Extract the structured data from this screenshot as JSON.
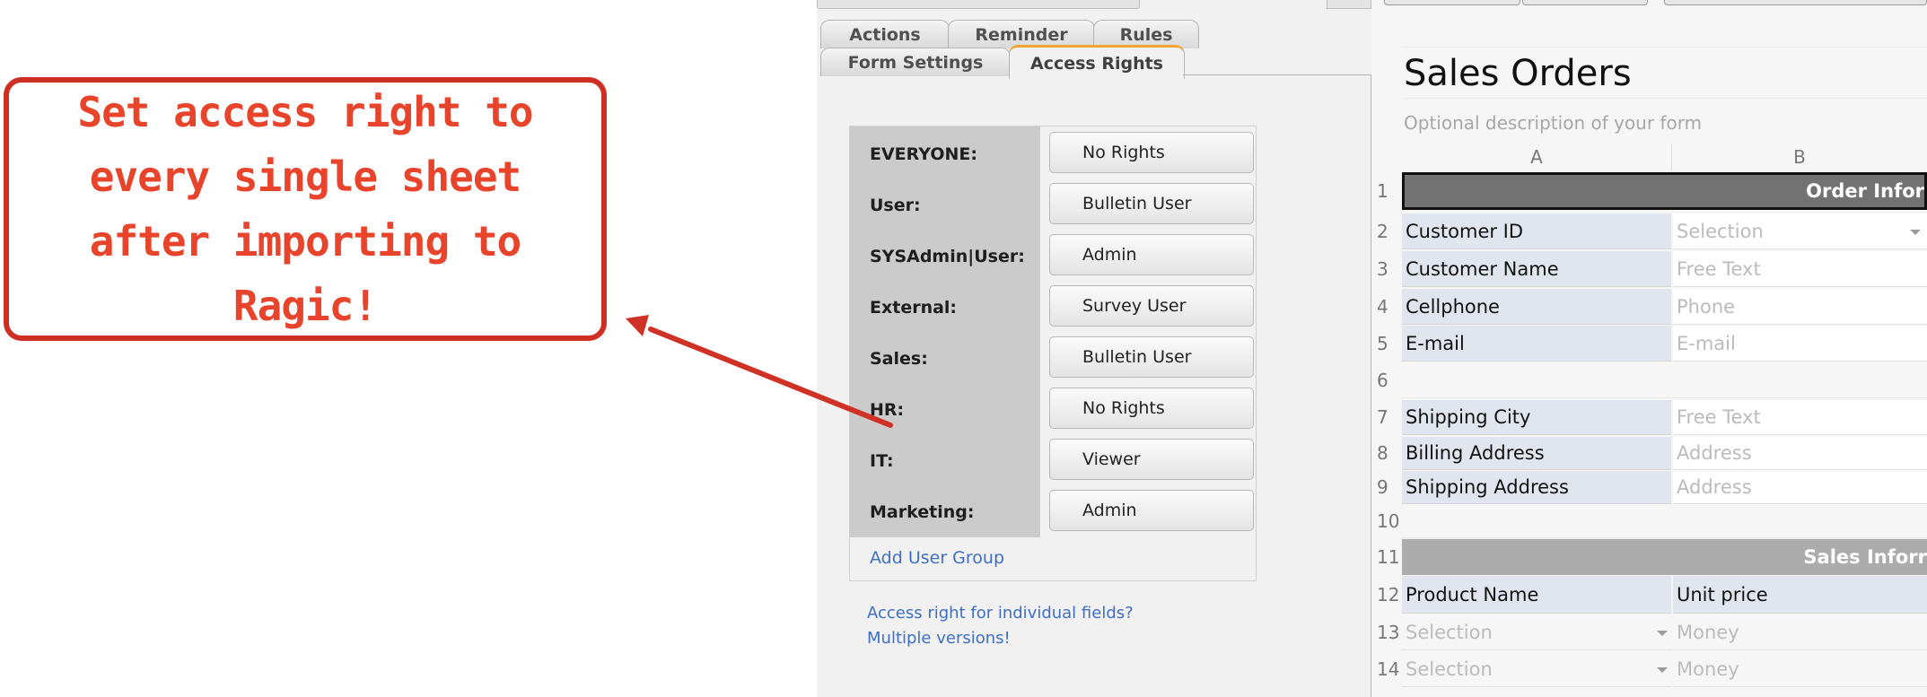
{
  "callout": {
    "lines": [
      "Set access right to",
      "every single sheet",
      "after importing to Ragic!"
    ],
    "color": "#e8442b",
    "border_color": "#cf2f22"
  },
  "settings": {
    "tabs_row1": [
      "Actions",
      "Reminder",
      "Rules"
    ],
    "tabs_row2": [
      "Form Settings",
      "Access Rights"
    ],
    "active_tab": "Access Rights",
    "groups": [
      {
        "name": "EVERYONE:",
        "right": "No Rights"
      },
      {
        "name": "User:",
        "right": "Bulletin User"
      },
      {
        "name": "SYSAdmin|User:",
        "right": "Admin"
      },
      {
        "name": "External:",
        "right": "Survey User"
      },
      {
        "name": "Sales:",
        "right": "Bulletin User"
      },
      {
        "name": "HR:",
        "right": "No Rights"
      },
      {
        "name": "IT:",
        "right": "Viewer"
      },
      {
        "name": "Marketing:",
        "right": "Admin"
      }
    ],
    "add_group_label": "Add User Group",
    "help_links": [
      "Access right for individual fields?",
      "Multiple versions!"
    ],
    "link_color": "#3f6fc4",
    "accent_color": "#f0a436"
  },
  "form": {
    "title": "Sales Orders",
    "description_placeholder": "Optional description of your form",
    "columns": [
      "A",
      "B"
    ],
    "rows": [
      {
        "num": "1",
        "type": "section",
        "text": "Order Infor"
      },
      {
        "num": "2",
        "label": "Customer ID",
        "field": "Selection",
        "dropdown": true
      },
      {
        "num": "3",
        "label": "Customer Name",
        "field": "Free Text"
      },
      {
        "num": "4",
        "label": "Cellphone",
        "field": "Phone"
      },
      {
        "num": "5",
        "label": "E-mail",
        "field": "E-mail"
      },
      {
        "num": "6",
        "type": "empty"
      },
      {
        "num": "7",
        "label": "Shipping City",
        "field": "Free Text"
      },
      {
        "num": "8",
        "label": "Billing Address",
        "field": "Address"
      },
      {
        "num": "9",
        "label": "Shipping Address",
        "field": "Address"
      },
      {
        "num": "10",
        "type": "empty"
      },
      {
        "num": "11",
        "type": "section2",
        "text": "Sales Inforr"
      },
      {
        "num": "12",
        "type": "subheader",
        "label": "Product Name",
        "label_b": "Unit price"
      },
      {
        "num": "13",
        "type": "subrow",
        "field_a": "Selection",
        "field_b": "Money"
      },
      {
        "num": "14",
        "type": "subrow",
        "field_a": "Selection",
        "field_b": "Money"
      }
    ]
  }
}
